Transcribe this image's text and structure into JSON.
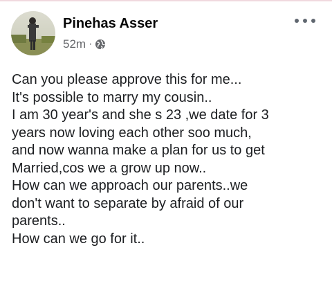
{
  "post": {
    "author": "Pinehas Asser",
    "timestamp": "52m",
    "separator": "·",
    "privacy_icon": "globe-icon",
    "more_icon": "more-options-icon",
    "lines": [
      "Can you please approve this for me...",
      "It's possible to marry my cousin..",
      "I am 30 year's and she s 23 ,we date for 3",
      "years now loving each other soo much,",
      "and now wanna make a plan for us to get",
      "Married,cos we a grow up now..",
      "How can we approach our parents..we",
      "don't want to separate by afraid of our",
      "parents..",
      "How can we go for it.."
    ]
  }
}
